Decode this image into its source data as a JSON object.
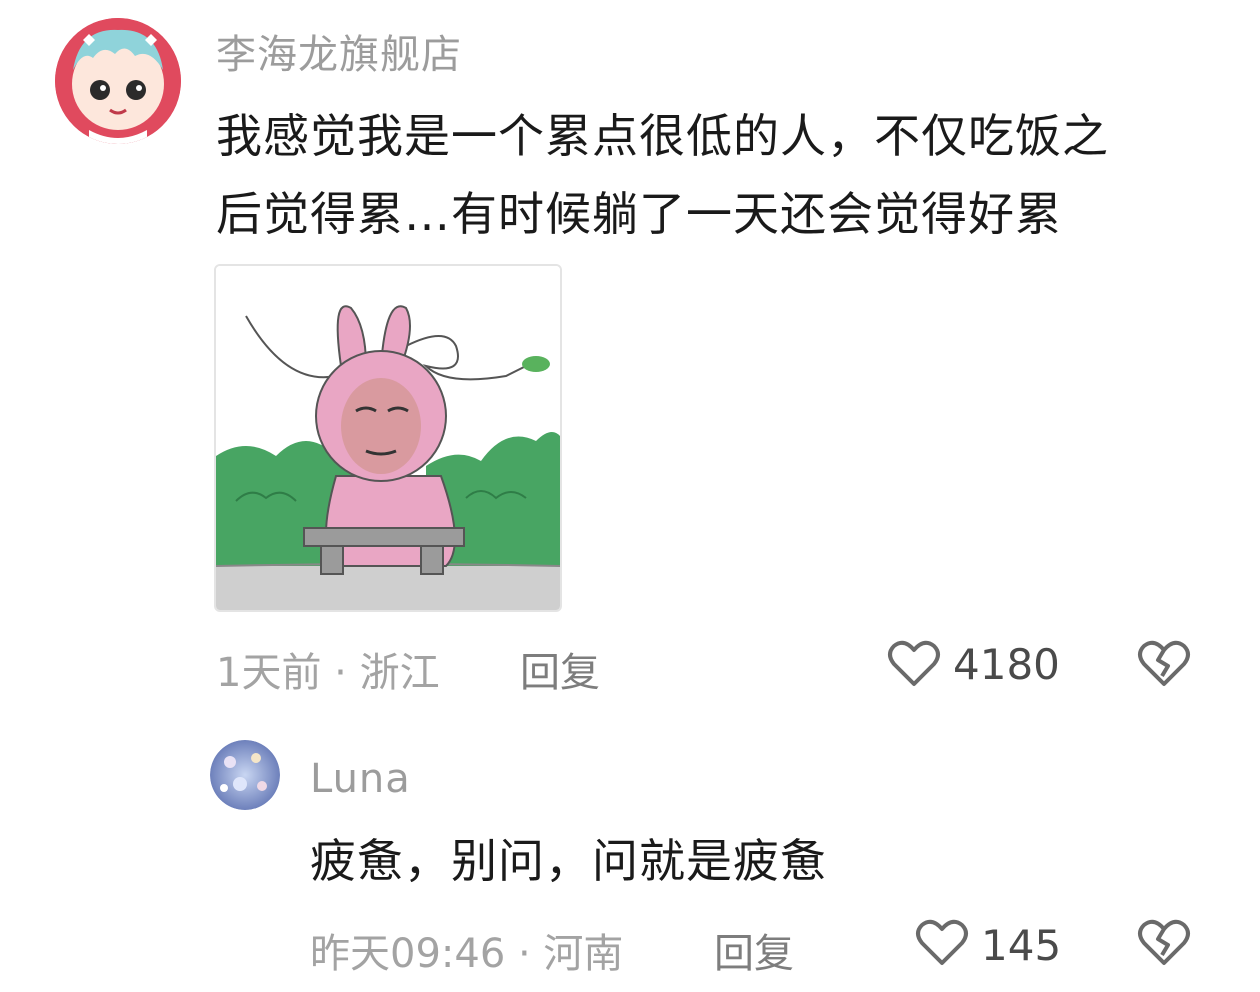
{
  "main_comment": {
    "username": "李海龙旗舰店",
    "text_line1": "我感觉我是一个累点很低的人，不仅吃饭之",
    "text_line2": "后觉得累…有时候躺了一天还会觉得好累",
    "time_location": "1天前 · 浙江",
    "reply_label": "回复",
    "like_count": "4180"
  },
  "reply_comment": {
    "username": "Luna",
    "text": "疲惫，别问，问就是疲惫",
    "time_location": "昨天09:46 · 河南",
    "reply_label": "回复",
    "like_count": "145"
  },
  "icons": [
    "avatar",
    "heart-icon",
    "dislike-heart-icon"
  ],
  "colors": {
    "avatar_red": "#e04a5e",
    "bush_green": "#48a563",
    "rabbit_pink": "#e9a6c4"
  }
}
